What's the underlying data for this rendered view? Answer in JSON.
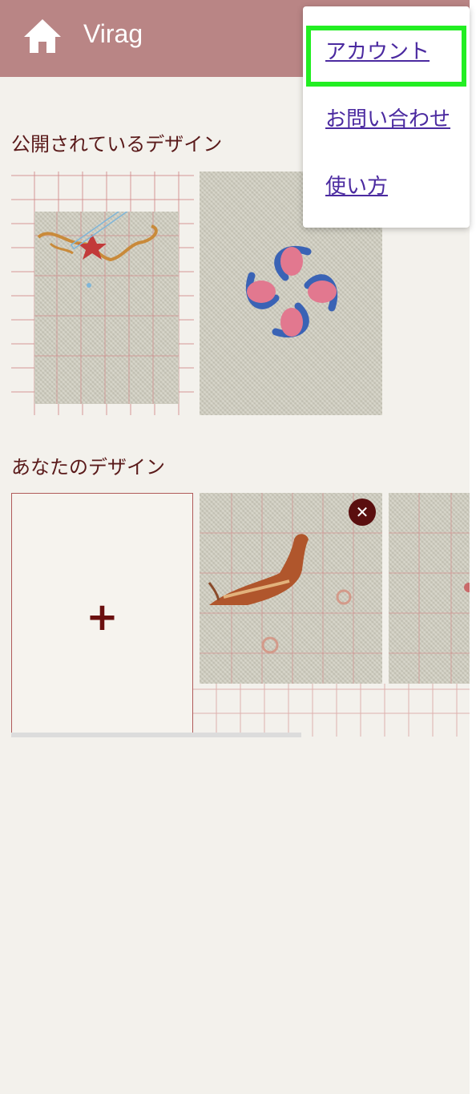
{
  "header": {
    "title": "Virag",
    "home_icon": "home-icon",
    "color": "#b98585"
  },
  "public_section": {
    "title": "公開されているデザイン"
  },
  "your_section": {
    "title": "あなたのデザイン",
    "add_label": "+",
    "delete_label": "✕"
  },
  "menu": {
    "items": [
      {
        "label": "アカウント",
        "highlighted": true
      },
      {
        "label": "お問い合わせ"
      },
      {
        "label": "使い方"
      }
    ],
    "highlight_color": "#22ee22"
  }
}
